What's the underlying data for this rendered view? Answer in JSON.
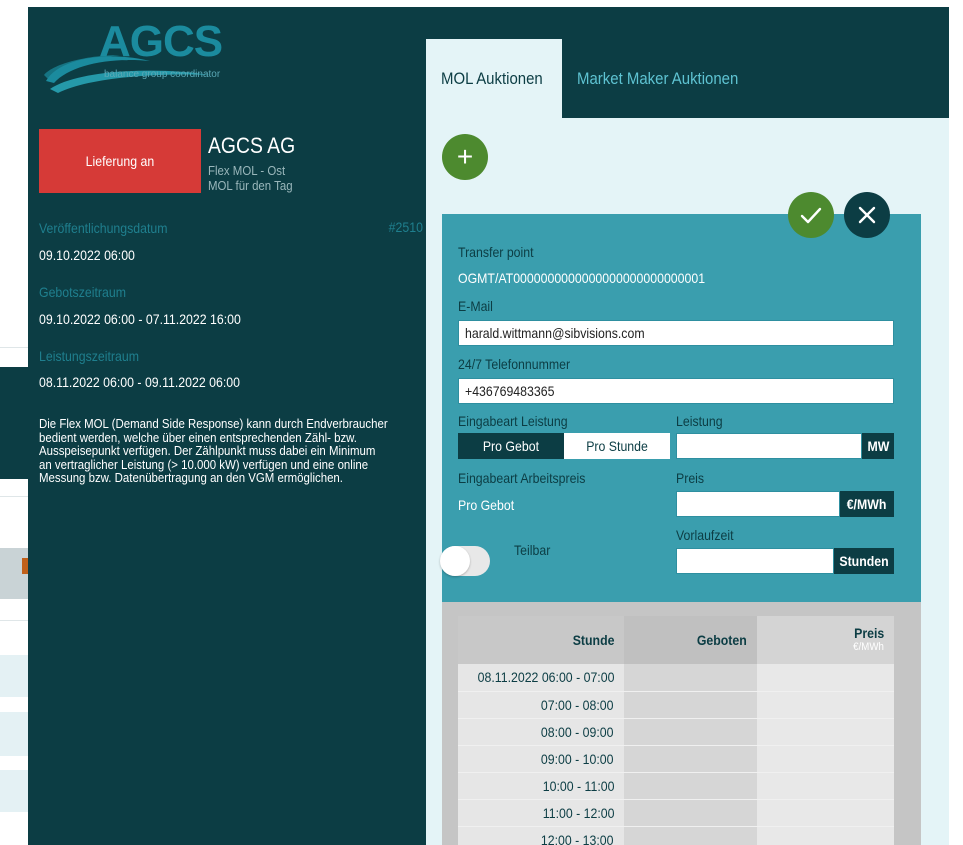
{
  "logo": {
    "brand": "AGCS",
    "tagline": "balance group coordinator"
  },
  "auction": {
    "delivery_button": "Lieferung an",
    "company": "AGCS AG",
    "product": "Flex MOL - Ost",
    "period_type": "MOL für den Tag",
    "id": "#2510",
    "publication_label": "Veröffentlichungsdatum",
    "publication_value": "09.10.2022 06:00",
    "bidding_label": "Gebotszeitraum",
    "bidding_value": "09.10.2022 06:00 - 07.11.2022 16:00",
    "service_label": "Leistungszeitraum",
    "service_value": "08.11.2022 06:00 - 09.11.2022 06:00",
    "description_lines": [
      "Die Flex MOL (Demand Side Response) kann durch Endverbraucher",
      "bedient werden, welche über einen entsprechenden Zähl- bzw.",
      "Ausspeisepunkt verfügen. Der Zählpunkt muss dabei ein Minimum",
      "an vertraglicher Leistung (> 10.000 kW) verfügen und eine online",
      "Messung bzw. Datenübertragung an den VGM ermöglichen."
    ]
  },
  "tabs": [
    {
      "label": "MOL Auktionen",
      "active": true
    },
    {
      "label": "Market Maker Auktionen",
      "active": false
    }
  ],
  "actions": {
    "add": "+",
    "confirm_icon": "check-icon",
    "close_icon": "close-icon"
  },
  "form": {
    "transfer_point_label": "Transfer point",
    "transfer_point_value": "OGMT/AT0000000000000000000000000001",
    "email_label": "E-Mail",
    "email_value": "harald.wittmann@sibvisions.com",
    "phone_label": "24/7 Telefonnummer",
    "phone_value": "+436769483365",
    "input_type_power_label": "Eingabeart Leistung",
    "seg_per_bid": "Pro Gebot",
    "seg_per_hour": "Pro Stunde",
    "power_label": "Leistung",
    "power_unit": "MW",
    "input_type_price_label": "Eingabeart Arbeitspreis",
    "input_type_price_value": "Pro Gebot",
    "price_label": "Preis",
    "price_unit": "€/MWh",
    "lead_time_label": "Vorlaufzeit",
    "lead_time_unit": "Stunden",
    "divisible_label": "Teilbar"
  },
  "table": {
    "headers": {
      "hour": "Stunde",
      "bid": "Geboten",
      "price": "Preis",
      "price_unit": "€/MWh"
    },
    "rows": [
      {
        "hour": "08.11.2022 06:00 - 07:00"
      },
      {
        "hour": "07:00 - 08:00"
      },
      {
        "hour": "08:00 - 09:00"
      },
      {
        "hour": "09:00 - 10:00"
      },
      {
        "hour": "10:00 - 11:00"
      },
      {
        "hour": "11:00 - 12:00"
      },
      {
        "hour": "12:00 - 13:00"
      }
    ]
  },
  "colors": {
    "dark_teal": "#0c3d44",
    "accent_teal": "#3a9eae",
    "red": "#d63a37",
    "green": "#4d8a2f",
    "light_bg": "#e4f4f7"
  }
}
